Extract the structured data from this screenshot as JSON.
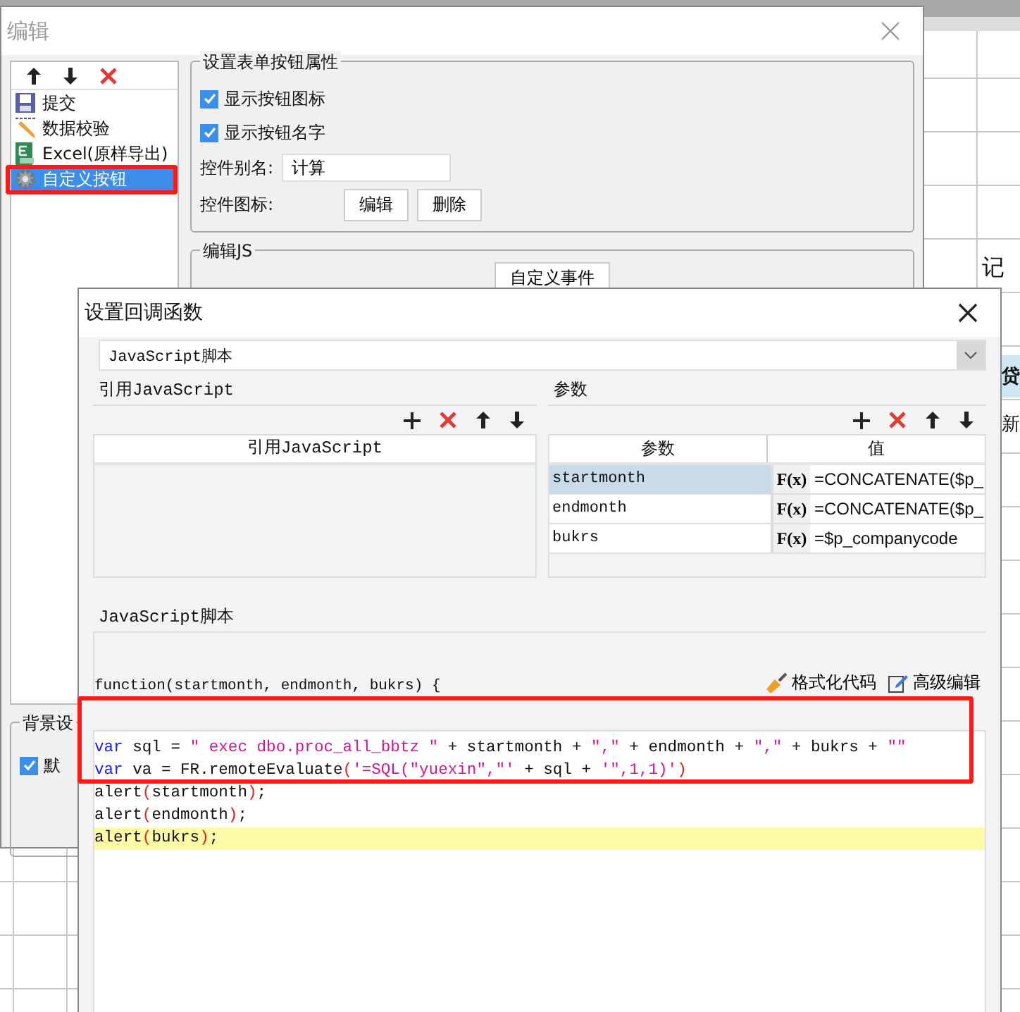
{
  "background": {
    "cells": [
      {
        "text": "记",
        "kind": "plain"
      },
      {
        "text": "贷",
        "kind": "header"
      },
      {
        "text": "新",
        "kind": "plain"
      }
    ]
  },
  "edit_window": {
    "title": "编辑",
    "items": [
      {
        "label": "提交",
        "kind": "save",
        "selected": false
      },
      {
        "label": "数据校验",
        "kind": "pencil",
        "selected": false
      },
      {
        "label": "Excel(原样导出)",
        "kind": "excel",
        "selected": false
      },
      {
        "label": "自定义按钮",
        "kind": "gear",
        "selected": true
      }
    ],
    "button_props": {
      "title": "设置表单按钮属性",
      "checkboxes": [
        {
          "label": "显示按钮图标",
          "checked": true
        },
        {
          "label": "显示按钮名字",
          "checked": true
        }
      ],
      "alias_label": "控件别名:",
      "alias_value": "计算",
      "icon_label": "控件图标:",
      "icon_buttons": [
        "编辑",
        "删除"
      ]
    },
    "edit_js": {
      "title": "编辑JS",
      "button": "自定义事件"
    },
    "background_settings": {
      "title": "背景设",
      "checkbox": {
        "label": "默",
        "checked": true
      }
    }
  },
  "callback_dialog": {
    "title": "设置回调函数",
    "type_select": "JavaScript脚本",
    "ref_section": {
      "title": "引用JavaScript",
      "column": "引用JavaScript"
    },
    "params": {
      "title": "参数",
      "columns": [
        "参数",
        "值"
      ],
      "rows": [
        {
          "name": "startmonth",
          "formula": "F(x)",
          "value": "=CONCATENATE($p_",
          "selected": true
        },
        {
          "name": "endmonth",
          "formula": "F(x)",
          "value": "=CONCATENATE($p_",
          "selected": false
        },
        {
          "name": "bukrs",
          "formula": "F(x)",
          "value": "=$p_companycode",
          "selected": false
        }
      ]
    },
    "script": {
      "title": "JavaScript脚本",
      "signature": "function(startmonth, endmonth, bukrs) {",
      "actions": [
        "格式化代码",
        "高级编辑"
      ],
      "lines": [
        {
          "highlighted": false,
          "tokens": [
            {
              "kind": "kw",
              "text": "var"
            },
            {
              "kind": "plain",
              "text": " sql = "
            },
            {
              "kind": "str",
              "text": "\" exec dbo.proc_all_bbtz \""
            },
            {
              "kind": "plain",
              "text": " + startmonth + "
            },
            {
              "kind": "str",
              "text": "\",\""
            },
            {
              "kind": "plain",
              "text": " + endmonth + "
            },
            {
              "kind": "str",
              "text": "\",\""
            },
            {
              "kind": "plain",
              "text": " + bukrs + "
            },
            {
              "kind": "str",
              "text": "\"\""
            }
          ]
        },
        {
          "highlighted": false,
          "tokens": [
            {
              "kind": "kw",
              "text": "var"
            },
            {
              "kind": "plain",
              "text": " va = FR.remoteEvaluate"
            },
            {
              "kind": "paren",
              "text": "("
            },
            {
              "kind": "str",
              "text": "'=SQL(\"yuexin\",\"'"
            },
            {
              "kind": "plain",
              "text": " + sql + "
            },
            {
              "kind": "str",
              "text": "'\",1,1)'"
            },
            {
              "kind": "paren",
              "text": ")"
            }
          ]
        },
        {
          "highlighted": false,
          "tokens": [
            {
              "kind": "plain",
              "text": "alert"
            },
            {
              "kind": "paren",
              "text": "("
            },
            {
              "kind": "plain",
              "text": "startmonth"
            },
            {
              "kind": "paren",
              "text": ")"
            },
            {
              "kind": "plain",
              "text": ";"
            }
          ]
        },
        {
          "highlighted": false,
          "tokens": [
            {
              "kind": "plain",
              "text": "alert"
            },
            {
              "kind": "paren",
              "text": "("
            },
            {
              "kind": "plain",
              "text": "endmonth"
            },
            {
              "kind": "paren",
              "text": ")"
            },
            {
              "kind": "plain",
              "text": ";"
            }
          ]
        },
        {
          "highlighted": true,
          "tokens": [
            {
              "kind": "plain",
              "text": "alert"
            },
            {
              "kind": "paren",
              "text": "("
            },
            {
              "kind": "plain",
              "text": "bukrs"
            },
            {
              "kind": "paren",
              "text": ")"
            },
            {
              "kind": "plain",
              "text": ";"
            }
          ]
        }
      ]
    }
  }
}
